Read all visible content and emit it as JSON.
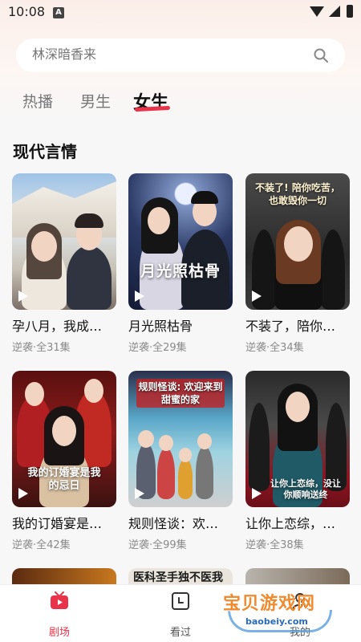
{
  "status_bar": {
    "time": "10:08",
    "notification_badge": "A"
  },
  "search": {
    "placeholder": "林深暗香来"
  },
  "tabs": [
    {
      "label": "热播",
      "active": false
    },
    {
      "label": "男生",
      "active": false
    },
    {
      "label": "女生",
      "active": true
    }
  ],
  "section": {
    "title": "现代言情"
  },
  "cards": [
    {
      "title": "孕八月，我成…",
      "meta": "逆袭·全31集",
      "cover_caption": ""
    },
    {
      "title": "月光照枯骨",
      "meta": "逆袭·全29集",
      "cover_caption": "月光照枯骨"
    },
    {
      "title": "不装了，陪你…",
      "meta": "逆袭·全34集",
      "cover_caption": "不装了! 陪你吃苦，也敢毁你一切"
    },
    {
      "title": "我的订婚宴是…",
      "meta": "逆袭·全42集",
      "cover_caption": "我的订婚宴是我的忌日"
    },
    {
      "title": "规则怪谈：欢…",
      "meta": "逆袭·全99集",
      "cover_caption": "规则怪谈: 欢迎来到甜蜜的家"
    },
    {
      "title": "让你上恋综，…",
      "meta": "逆袭·全38集",
      "cover_caption": "让你上恋综，没让你顺响送终"
    }
  ],
  "partial_row": {
    "middle_caption": "医科圣手独不医我"
  },
  "bottom_nav": [
    {
      "label": "剧场",
      "icon": "tv-icon",
      "active": true
    },
    {
      "label": "看过",
      "icon": "history-icon",
      "active": false
    },
    {
      "label": "我的",
      "icon": "profile-icon",
      "active": false
    }
  ],
  "watermark": {
    "text": "宝贝游戏网",
    "url": "baobeiy.com"
  },
  "colors": {
    "accent": "#e8334a",
    "background": "#f7f7f7",
    "meta_text": "#8a8a8a"
  }
}
